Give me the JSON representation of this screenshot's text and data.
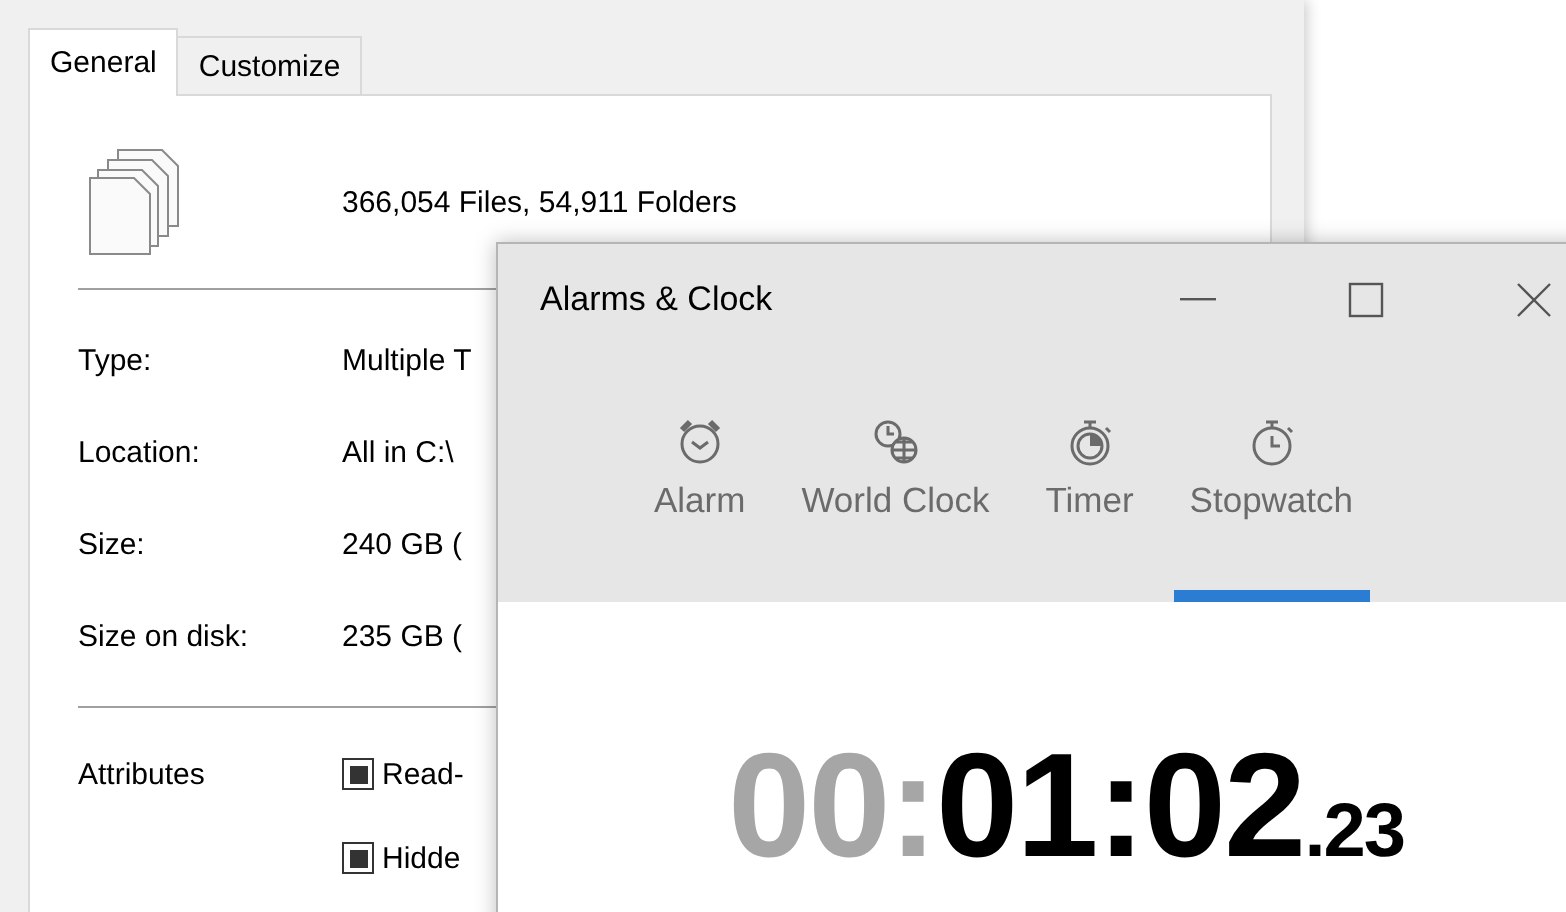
{
  "properties": {
    "tabs": [
      {
        "label": "General",
        "selected": true
      },
      {
        "label": "Customize",
        "selected": false
      }
    ],
    "summary": "366,054 Files, 54,911 Folders",
    "fields": [
      {
        "label": "Type:",
        "value": "Multiple T"
      },
      {
        "label": "Location:",
        "value": "All in C:\\"
      },
      {
        "label": "Size:",
        "value": "240 GB ("
      },
      {
        "label": "Size on disk:",
        "value": "235 GB ("
      }
    ],
    "attributes": {
      "label": "Attributes",
      "items": [
        {
          "label": "Read-",
          "indeterminate": true
        },
        {
          "label": "Hidde",
          "indeterminate": true
        }
      ]
    }
  },
  "clock": {
    "title": "Alarms & Clock",
    "tabs": [
      {
        "label": "Alarm",
        "kind": "alarm",
        "selected": false
      },
      {
        "label": "World Clock",
        "kind": "world",
        "selected": false
      },
      {
        "label": "Timer",
        "kind": "timer",
        "selected": false
      },
      {
        "label": "Stopwatch",
        "kind": "stopwatch",
        "selected": true
      }
    ],
    "time": [
      {
        "text": "00",
        "kind": "dim"
      },
      {
        "text": ":",
        "kind": "dim"
      },
      {
        "text": "01:02",
        "kind": "main"
      },
      {
        "text": ".23",
        "kind": "fraction"
      }
    ]
  }
}
